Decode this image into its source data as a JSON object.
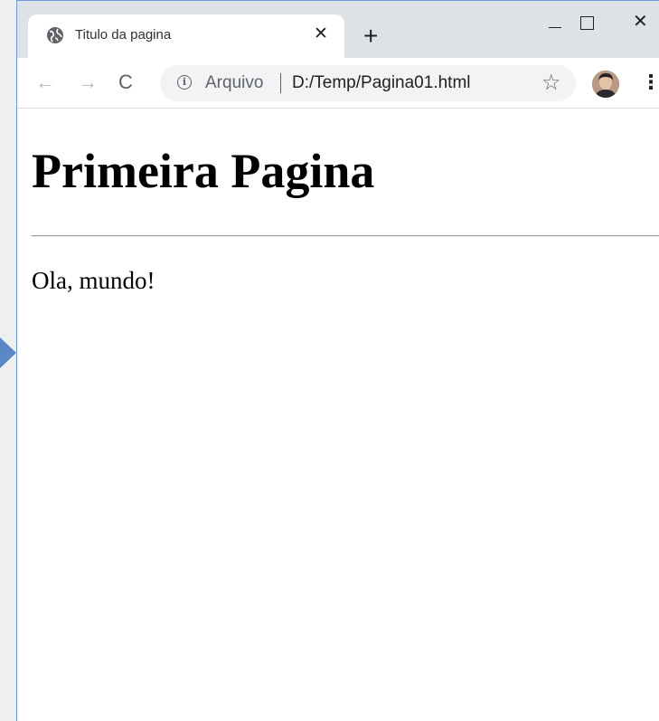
{
  "browser": {
    "tab": {
      "title": "Titulo da pagina",
      "close_glyph": "✕",
      "favicon": "globe-icon"
    },
    "new_tab_glyph": "+",
    "window_controls": {
      "minimize": "minimize-icon",
      "maximize": "maximize-icon",
      "close_glyph": "✕"
    },
    "toolbar": {
      "back_glyph": "←",
      "forward_glyph": "→",
      "reload_glyph": "C",
      "scheme_label": "Arquivo",
      "url": "D:/Temp/Pagina01.html",
      "bookmark_glyph": "☆",
      "menu_glyph": "⋮"
    },
    "colors": {
      "accent": "#5b87c7",
      "titlebar": "#dee1e6"
    }
  },
  "page": {
    "heading": "Primeira Pagina",
    "paragraph": "Ola, mundo!"
  }
}
